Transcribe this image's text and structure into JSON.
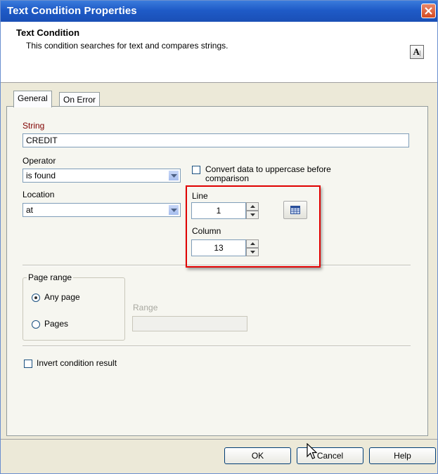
{
  "window": {
    "title": "Text Condition Properties"
  },
  "header": {
    "title": "Text Condition",
    "description": "This condition searches for text and compares strings.",
    "icon": "text-icon"
  },
  "tabs": [
    {
      "label": "General",
      "active": true
    },
    {
      "label": "On Error",
      "active": false
    }
  ],
  "form": {
    "string_label": "String",
    "string_value": "CREDIT",
    "operator_label": "Operator",
    "operator_value": "is found",
    "uppercase_label_line1": "Convert data to uppercase before",
    "uppercase_label_line2": "comparison",
    "uppercase_checked": false,
    "location_label": "Location",
    "location_value": "at",
    "line_label": "Line",
    "line_value": "1",
    "column_label": "Column",
    "column_value": "13",
    "page_range_legend": "Page range",
    "any_page_label": "Any page",
    "pages_label": "Pages",
    "range_label": "Range",
    "range_value": "",
    "invert_label": "Invert condition result",
    "invert_checked": false
  },
  "buttons": {
    "ok": "OK",
    "cancel": "Cancel",
    "help": "Help"
  },
  "colors": {
    "title_bar": "#1f5bc7",
    "highlight_box": "#e00000",
    "string_label": "#800000"
  }
}
